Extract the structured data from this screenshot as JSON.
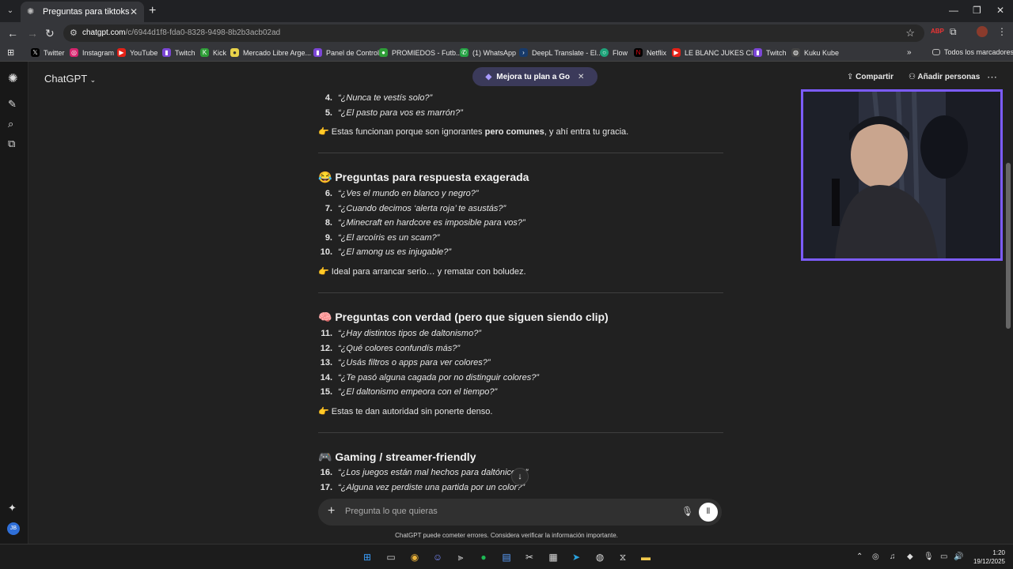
{
  "browser": {
    "tab_title": "Preguntas para tiktoks",
    "url_host": "chatgpt.com",
    "url_path": "/c/6944d1f8-fda0-8328-9498-8b2b3acb02ad",
    "bookmarks": [
      "Twitter",
      "Instagram",
      "YouTube",
      "Twitch",
      "Kick",
      "Mercado Libre Arge...",
      "Panel de Control",
      "PROMIEDOS - Futb...",
      "(1) WhatsApp",
      "DeepL Translate - El...",
      "Flow",
      "Netflix",
      "LE BLANC JUKES CI...",
      "Twitch",
      "Kuku Kube"
    ],
    "all_bookmarks": "Todos los marcadores"
  },
  "header": {
    "model": "ChatGPT",
    "upgrade": "Mejora tu plan a Go",
    "share": "Compartir",
    "add_people": "Añadir personas"
  },
  "sidebar": {
    "avatar": "JB"
  },
  "content": {
    "items_top": [
      {
        "n": "4.",
        "q": "“¿Nunca te vestís solo?”"
      },
      {
        "n": "5.",
        "q": "“¿El pasto para vos es marrón?”"
      }
    ],
    "note1_pre": "👉 Estas funcionan porque son ignorantes ",
    "note1_bold": "pero comunes",
    "note1_post": ", y ahí entra tu gracia.",
    "section2_title": "😂 Preguntas para respuesta exagerada",
    "section2_items": [
      {
        "n": "6.",
        "q": "“¿Ves el mundo en blanco y negro?”"
      },
      {
        "n": "7.",
        "q": "“¿Cuando decimos ‘alerta roja’ te asustás?”"
      },
      {
        "n": "8.",
        "q": "“¿Minecraft en hardcore es imposible para vos?”"
      },
      {
        "n": "9.",
        "q": "“¿El arcoíris es un scam?”"
      },
      {
        "n": "10.",
        "q": "“¿El among us es injugable?”"
      }
    ],
    "note2": "👉 Ideal para arrancar serio… y rematar con boludez.",
    "section3_title": "🧠 Preguntas con verdad (pero que siguen siendo clip)",
    "section3_items": [
      {
        "n": "11.",
        "q": "“¿Hay distintos tipos de daltonismo?”"
      },
      {
        "n": "12.",
        "q": "“¿Qué colores confundís más?”"
      },
      {
        "n": "13.",
        "q": "“¿Usás filtros o apps para ver colores?”"
      },
      {
        "n": "14.",
        "q": "“¿Te pasó alguna cagada por no distinguir colores?”"
      },
      {
        "n": "15.",
        "q": "“¿El daltonismo empeora con el tiempo?”"
      }
    ],
    "note3": "👉 Estas te dan autoridad sin ponerte denso.",
    "section4_title": "🎮 Gaming / streamer-friendly",
    "section4_items": [
      {
        "n": "16.",
        "q": "“¿Los juegos están mal hechos para daltónicos?”"
      },
      {
        "n": "17.",
        "q": "“¿Alguna vez perdiste una partida por un color?”"
      }
    ]
  },
  "composer": {
    "placeholder": "Pregunta lo que quieras",
    "disclaimer": "ChatGPT puede cometer errores. Considera verificar la información importante."
  },
  "taskbar": {
    "time": "1:20",
    "date": "19/12/2025"
  },
  "colors": {
    "accent": "#7c5cff",
    "background": "#212121"
  }
}
